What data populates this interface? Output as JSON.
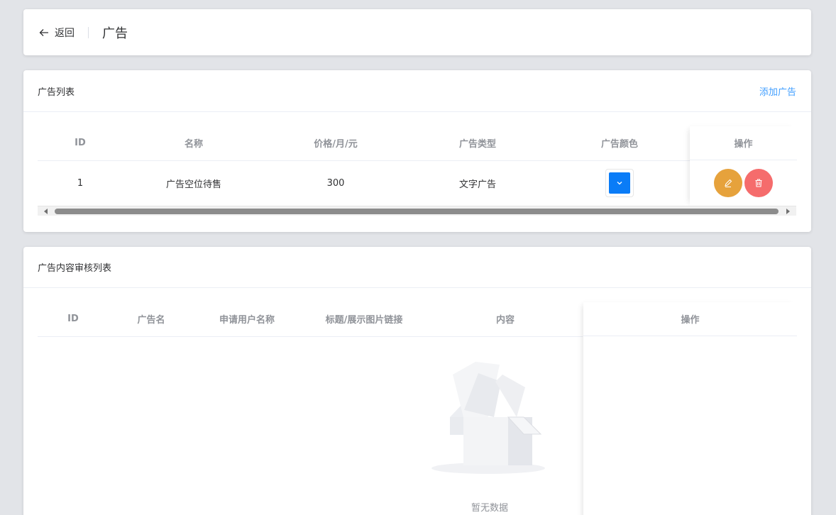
{
  "header": {
    "back_label": "返回",
    "title": "广告"
  },
  "ads": {
    "title": "广告列表",
    "add_label": "添加广告",
    "columns": [
      "ID",
      "名称",
      "价格/月/元",
      "广告类型",
      "广告颜色"
    ],
    "actions_header": "操作",
    "rows": [
      {
        "id": "1",
        "name": "广告空位待售",
        "price": "300",
        "type": "文字广告",
        "color": "#0a7cf7"
      }
    ],
    "scroll_position": 0.02
  },
  "review": {
    "title": "广告内容审核列表",
    "columns": [
      "ID",
      "广告名",
      "申请用户名称",
      "标题/展示图片链接",
      "内容"
    ],
    "actions_header": "操作",
    "empty_text": "暂无数据"
  },
  "colors": {
    "accent": "#409eff",
    "edit": "#e6a23c",
    "delete": "#f56c6c",
    "background": "#e2e4e8"
  }
}
